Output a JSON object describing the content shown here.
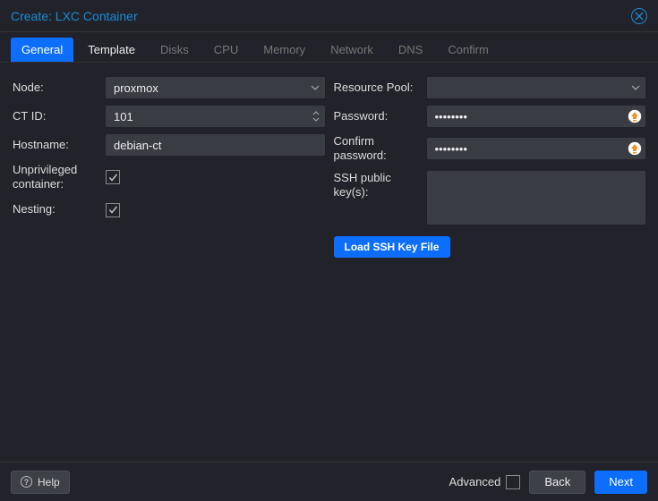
{
  "title": "Create: LXC Container",
  "tabs": [
    {
      "label": "General",
      "state": "active"
    },
    {
      "label": "Template",
      "state": "enabled"
    },
    {
      "label": "Disks",
      "state": "disabled"
    },
    {
      "label": "CPU",
      "state": "disabled"
    },
    {
      "label": "Memory",
      "state": "disabled"
    },
    {
      "label": "Network",
      "state": "disabled"
    },
    {
      "label": "DNS",
      "state": "disabled"
    },
    {
      "label": "Confirm",
      "state": "disabled"
    }
  ],
  "left": {
    "node_label": "Node:",
    "node_value": "proxmox",
    "ctid_label": "CT ID:",
    "ctid_value": "101",
    "hostname_label": "Hostname:",
    "hostname_value": "debian-ct",
    "unpriv_label": "Unprivileged container:",
    "unpriv_checked": true,
    "nesting_label": "Nesting:",
    "nesting_checked": true
  },
  "right": {
    "pool_label": "Resource Pool:",
    "pool_value": "",
    "pw_label": "Password:",
    "pw_value": "••••••••",
    "pwc_label": "Confirm password:",
    "pwc_value": "••••••••",
    "ssh_label": "SSH public key(s):",
    "ssh_value": "",
    "load_btn": "Load SSH Key File"
  },
  "footer": {
    "help": "Help",
    "advanced": "Advanced",
    "advanced_checked": false,
    "back": "Back",
    "next": "Next"
  }
}
